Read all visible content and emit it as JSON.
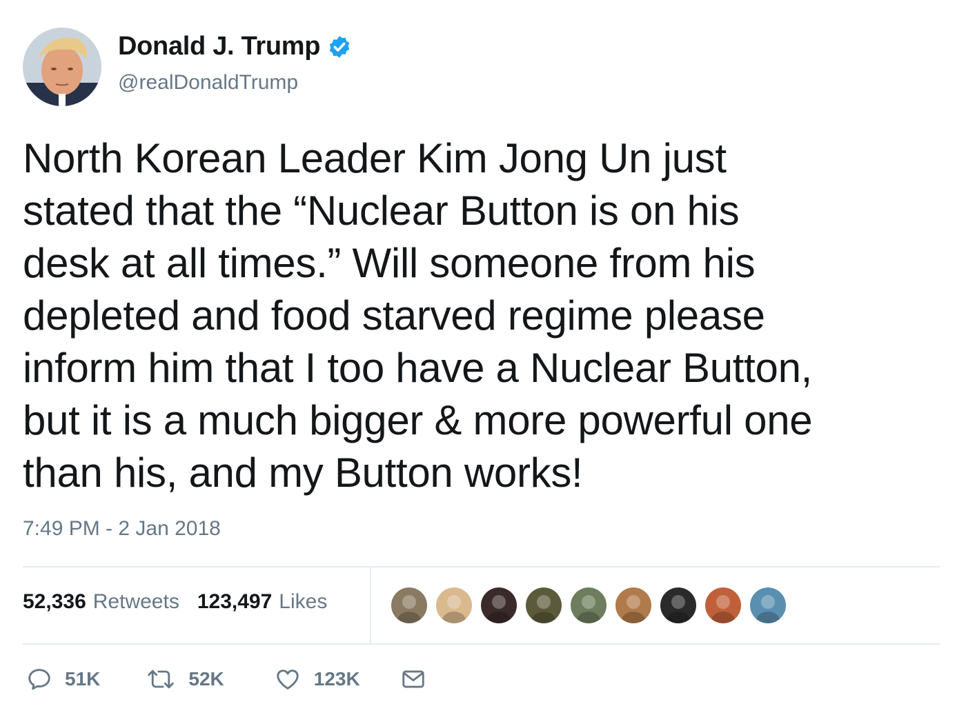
{
  "author": {
    "display_name": "Donald J. Trump",
    "handle": "@realDonaldTrump",
    "verified_icon": "verified-badge-icon",
    "accent_color": "#1da1f2"
  },
  "tweet": {
    "text": "North Korean Leader Kim Jong Un just\nstated that the “Nuclear Button is on his\ndesk at all times.” Will someone from his\ndepleted and food starved regime please\ninform him that I too have a Nuclear Button,\nbut it is a much bigger & more powerful one\nthan his, and my Button works!",
    "timestamp": "7:49 PM - 2 Jan 2018"
  },
  "stats": {
    "retweets_count": "52,336",
    "retweets_label": "Retweets",
    "likes_count": "123,497",
    "likes_label": "Likes"
  },
  "likers": {
    "count_shown": 9,
    "colors": [
      "#8a7a62",
      "#d9b98e",
      "#3b2a2a",
      "#5b5a3a",
      "#6e7d5e",
      "#b07a4a",
      "#2a2a2a",
      "#c0603a",
      "#5a8fb0"
    ]
  },
  "actions": {
    "reply_count": "51K",
    "retweet_count": "52K",
    "like_count": "123K",
    "icons": [
      "reply-icon",
      "retweet-icon",
      "like-icon",
      "direct-message-icon"
    ]
  }
}
